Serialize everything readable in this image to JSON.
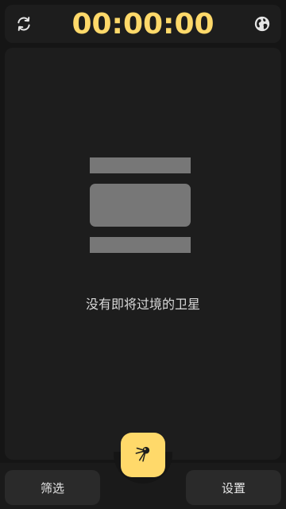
{
  "topbar": {
    "timer": "00:00:00",
    "refresh_icon": "refresh-icon",
    "globe_icon": "globe-icon"
  },
  "main": {
    "empty_message": "没有即将过境的卫星",
    "illustration": "empty-list-illustration"
  },
  "bottombar": {
    "filter_label": "筛选",
    "settings_label": "设置",
    "fab_icon": "satellite-icon"
  },
  "colors": {
    "accent": "#ffd96a",
    "background": "#151515",
    "panel": "#1d1d1d",
    "button": "#2a2a2a",
    "placeholder": "#777777"
  }
}
